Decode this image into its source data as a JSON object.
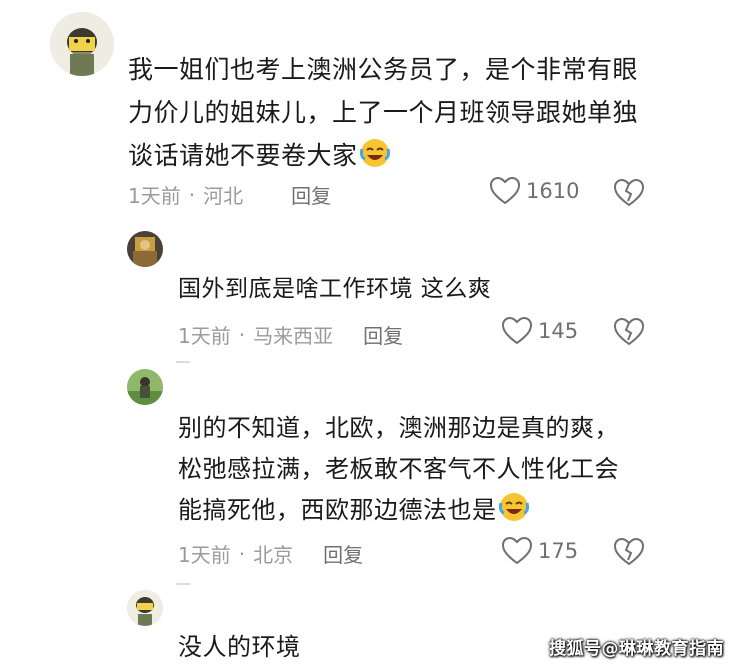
{
  "comments": [
    {
      "lines": [
        "我一姐们也考上澳洲公务员了，是个非常有眼",
        "力价儿的姐妹儿，上了一个月班领导跟她单独",
        "谈话请她不要卷大家"
      ],
      "emoji": "laughing-crying-emoji",
      "time": "1天前",
      "location": "河北",
      "reply_label": "回复",
      "likes": "1610"
    },
    {
      "lines": [
        "国外到底是啥工作环境 这么爽"
      ],
      "time": "1天前",
      "location": "马来西亚",
      "reply_label": "回复",
      "likes": "145"
    },
    {
      "lines": [
        "别的不知道，北欧，澳洲那边是真的爽，",
        "松弛感拉满，老板敢不客气不人性化工会",
        "能搞死他，西欧那边德法也是"
      ],
      "emoji": "laughing-crying-emoji",
      "time": "1天前",
      "location": "北京",
      "reply_label": "回复",
      "likes": "175"
    },
    {
      "lines": [
        "没人的环境"
      ]
    }
  ],
  "watermark": "搜狐号@琳琳教育指南",
  "colors": {
    "meta": "#9b9b9f",
    "text": "#1a1a1a",
    "icon": "#6f6f74"
  }
}
